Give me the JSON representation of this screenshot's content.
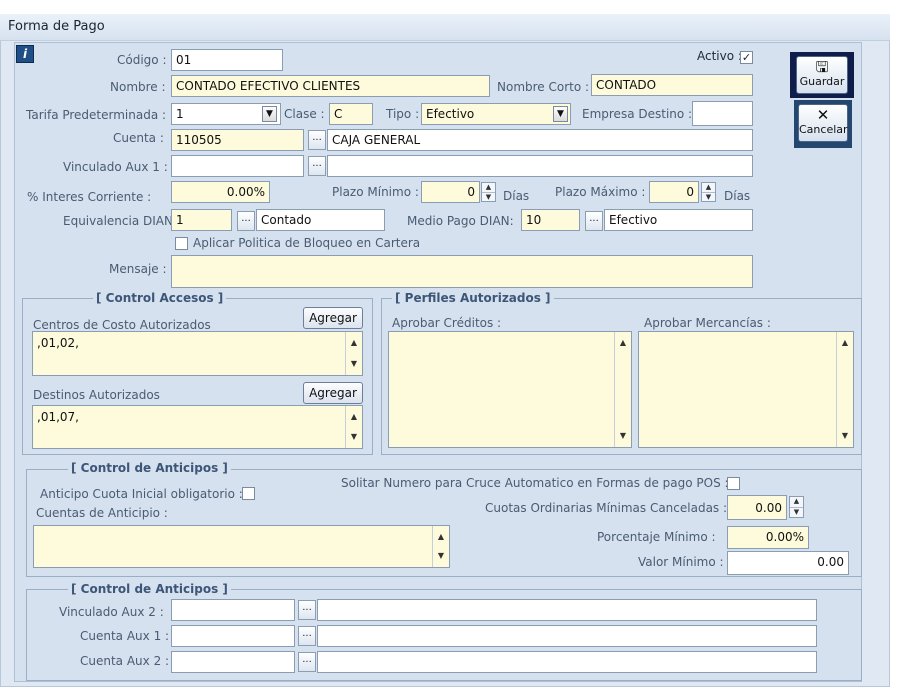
{
  "window": {
    "title": "Forma de Pago"
  },
  "info_icon": "i",
  "fields": {
    "codigo": {
      "label": "Código :",
      "value": "01"
    },
    "activo": {
      "label": "Activo :",
      "checked": "✓"
    },
    "nombre": {
      "label": "Nombre :",
      "value": "CONTADO EFECTIVO CLIENTES"
    },
    "nombre_corto": {
      "label": "Nombre Corto :",
      "value": "CONTADO"
    },
    "tarifa": {
      "label": "Tarifa Predeterminada :",
      "value": "1"
    },
    "clase": {
      "label": "Clase :",
      "value": "C"
    },
    "tipo": {
      "label": "Tipo :",
      "value": "Efectivo"
    },
    "empresa_destino": {
      "label": "Empresa Destino :",
      "value": ""
    },
    "cuenta": {
      "label": "Cuenta :",
      "code": "110505",
      "name": "CAJA GENERAL"
    },
    "vinculado_aux1": {
      "label": "Vinculado  Aux 1 :",
      "code": "",
      "name": ""
    },
    "interes": {
      "label": "% Interes Corriente :",
      "value": "0.00%"
    },
    "plazo_minimo": {
      "label": "Plazo Mínimo :",
      "value": "0",
      "unit": "Días"
    },
    "plazo_maximo": {
      "label": "Plazo Máximo :",
      "value": "0",
      "unit": "Días"
    },
    "equivalencia": {
      "label": "Equivalencia DIAN:",
      "code": "1",
      "name": "Contado"
    },
    "medio_pago": {
      "label": "Medio Pago DIAN:",
      "code": "10",
      "name": "Efectivo"
    },
    "politica": {
      "label": "Aplicar Politica de Bloqueo en Cartera"
    },
    "mensaje": {
      "label": "Mensaje :",
      "value": ""
    }
  },
  "buttons": {
    "guardar": "Guardar",
    "cancelar": "Cancelar",
    "agregar": "Agregar",
    "dots": "..."
  },
  "control_accesos": {
    "title": "[ Control Accesos ]",
    "centros_label": "Centros de Costo Autorizados",
    "centros_value": ",01,02,",
    "destinos_label": "Destinos Autorizados",
    "destinos_value": ",01,07,"
  },
  "perfiles": {
    "title": "[ Perfiles Autorizados ]",
    "creditos_label": "Aprobar Créditos :",
    "mercancias_label": "Aprobar Mercancías :"
  },
  "anticipos": {
    "title": "[ Control de Anticipos ]",
    "solicitar_label": "Solitar Numero para Cruce Automatico en Formas  de pago POS :",
    "cuota_label": "Anticipo Cuota Inicial obligatorio :",
    "cuentas_label": "Cuentas de Anticipio :",
    "cuotas_label": "Cuotas Ordinarias Mínimas Canceladas :",
    "cuotas_value": "0.00",
    "porcentaje_label": "Porcentaje Mínimo  :",
    "porcentaje_value": "0.00%",
    "valor_label": "Valor Mínimo :",
    "valor_value": "0.00"
  },
  "anticipos2": {
    "title": "[ Control de Anticipos ]",
    "rows": [
      {
        "label": "Vinculado  Aux 2 :"
      },
      {
        "label": "Cuenta Aux 1 :"
      },
      {
        "label": "Cuenta Aux 2 :"
      }
    ]
  }
}
